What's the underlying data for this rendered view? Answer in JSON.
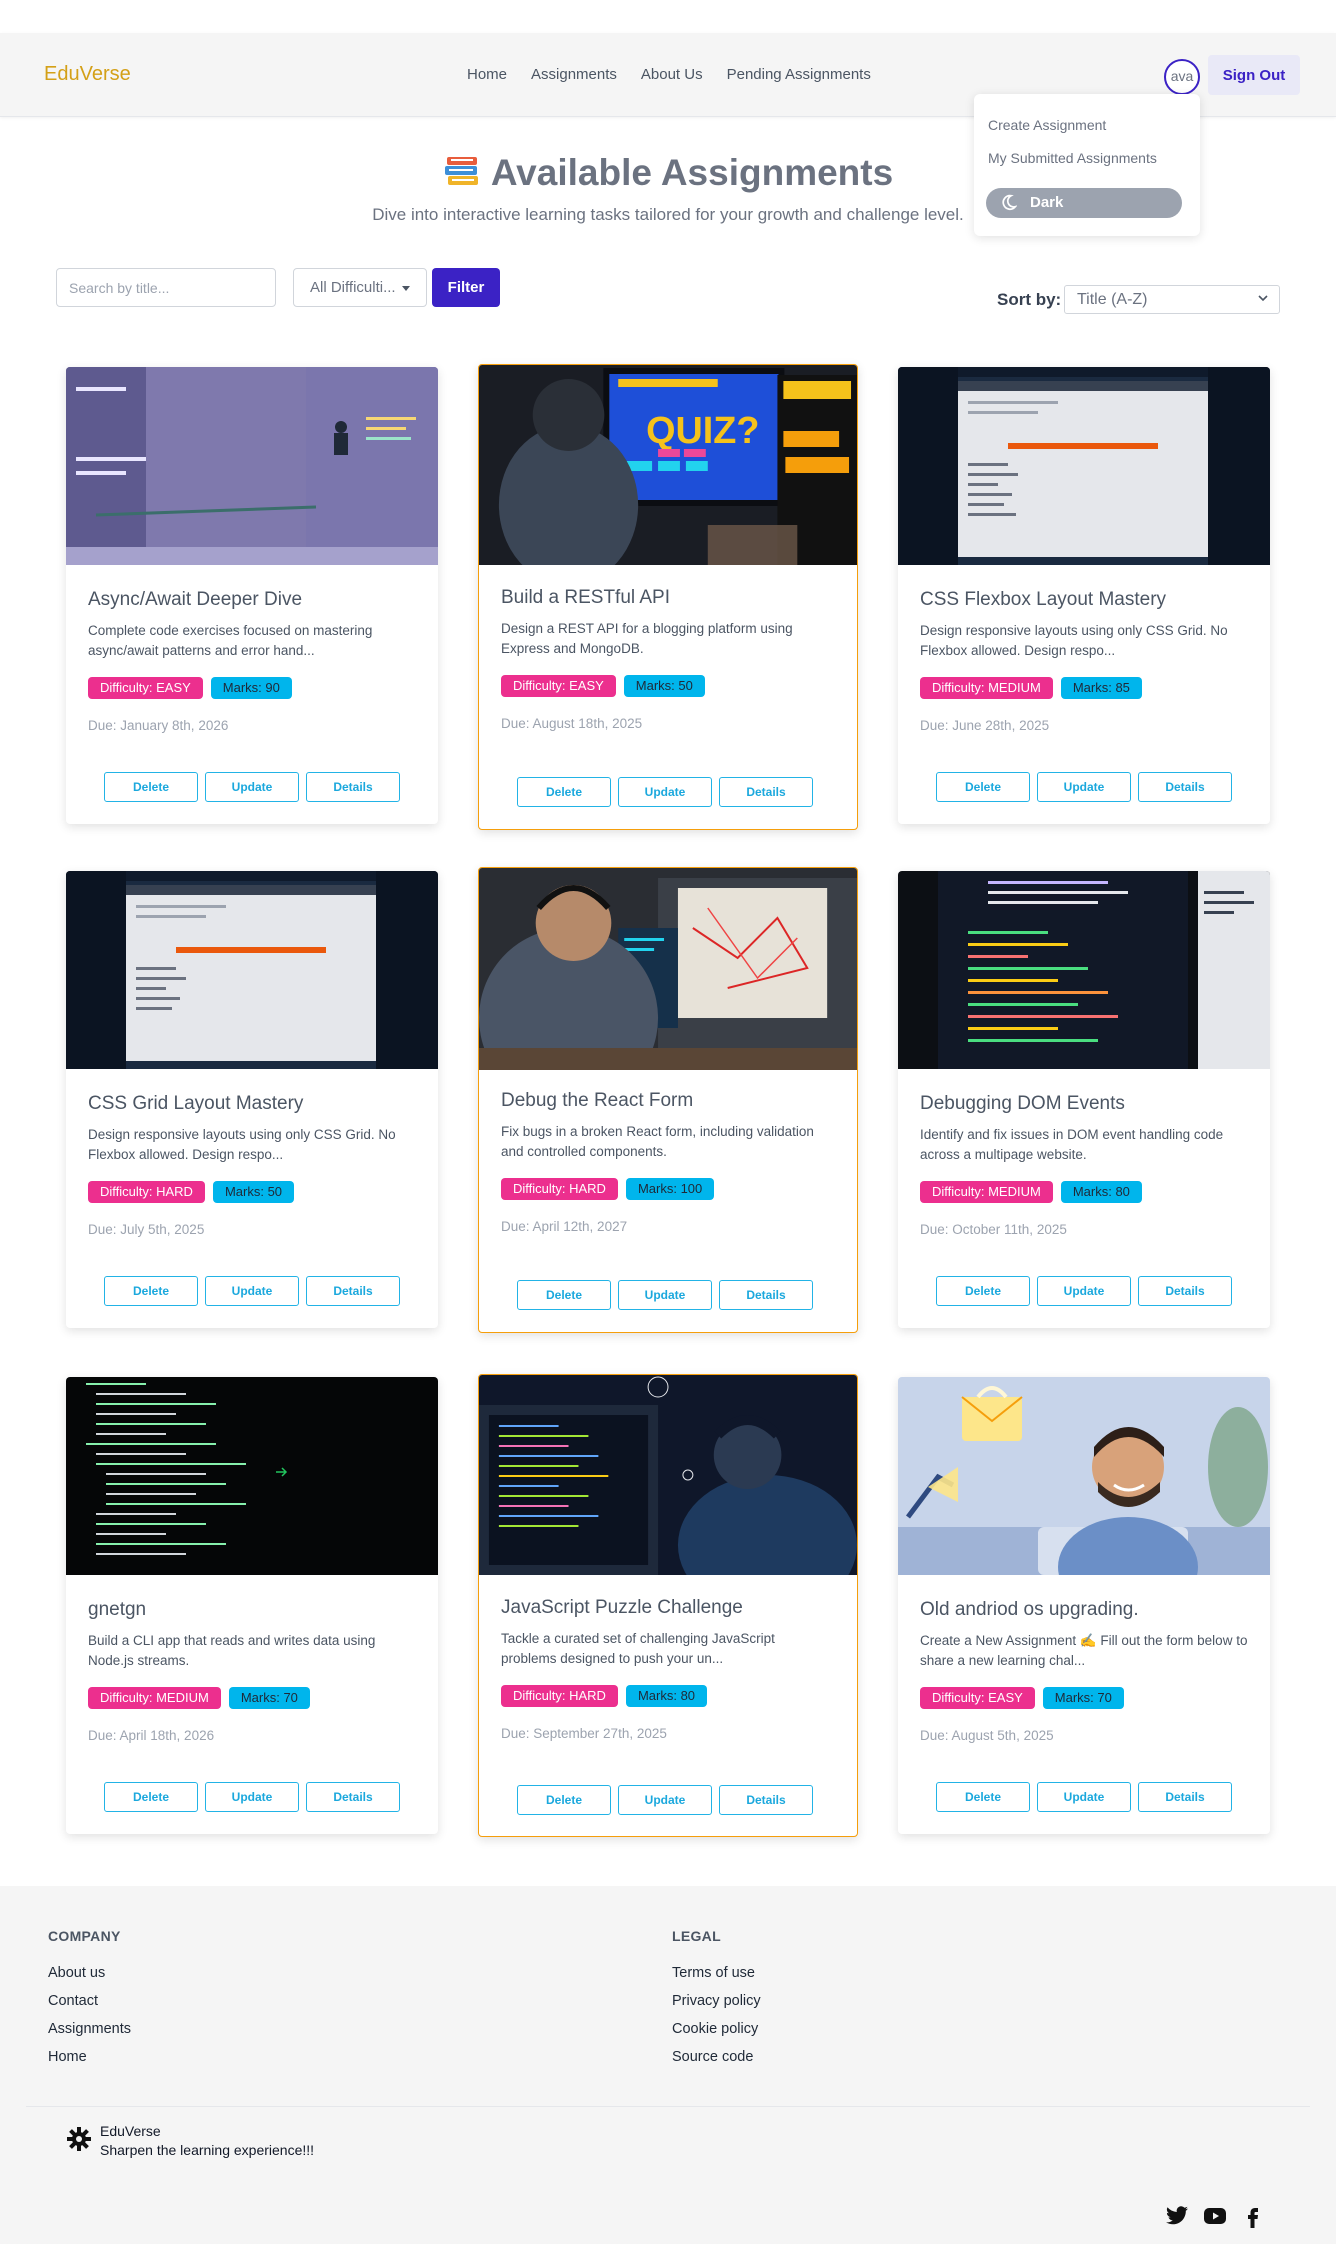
{
  "nav": {
    "brand": "EduVerse",
    "links": [
      "Home",
      "Assignments",
      "About Us",
      "Pending Assignments"
    ],
    "avatar_text": "ava",
    "signout": "Sign Out"
  },
  "user_menu": {
    "items": [
      "Create Assignment",
      "My Submitted Assignments"
    ],
    "theme_toggle": "Dark"
  },
  "hero": {
    "emoji": "books-icon",
    "title": "Available Assignments",
    "subtitle": "Dive into interactive learning tasks tailored for your growth and challenge level."
  },
  "filters": {
    "search_placeholder": "Search by title...",
    "difficulty_selected": "All Difficulti...",
    "filter_button": "Filter",
    "sort_label": "Sort by:",
    "sort_selected": "Title (A-Z)"
  },
  "colors": {
    "brand": "#d4a017",
    "primary": "#3b22c5",
    "difficulty_badge": "#ec2f8e",
    "marks_badge": "#00b5ec",
    "action_border": "#22b3e6",
    "featured_border": "#f59e0b"
  },
  "cards": [
    {
      "title": "Async/Await Deeper Dive",
      "description": "Complete code exercises focused on mastering async/await patterns and error hand...",
      "difficulty": "Difficulty: EASY",
      "marks": "Marks: 90",
      "due": "Due: January 8th, 2026",
      "image": "whiteboard-timeline-illustration",
      "delete": "Delete",
      "update": "Update",
      "details": "Details"
    },
    {
      "title": "Build a RESTful API",
      "description": "Design a REST API for a blogging platform using Express and MongoDB.",
      "difficulty": "Difficulty: EASY",
      "marks": "Marks: 50",
      "due": "Due: August 18th, 2025",
      "image": "quiz-monitor-photo",
      "quiz_text": "QUIZ?",
      "delete": "Delete",
      "update": "Update",
      "details": "Details"
    },
    {
      "title": "CSS Flexbox Layout Mastery",
      "description": "Design responsive layouts using only CSS Grid. No Flexbox allowed. Design respo...",
      "difficulty": "Difficulty: MEDIUM",
      "marks": "Marks: 85",
      "due": "Due: June 28th, 2025",
      "image": "laptop-code-photo",
      "delete": "Delete",
      "update": "Update",
      "details": "Details"
    },
    {
      "title": "CSS Grid Layout Mastery",
      "description": "Design responsive layouts using only CSS Grid. No Flexbox allowed. Design respo...",
      "difficulty": "Difficulty: HARD",
      "marks": "Marks: 50",
      "due": "Due: July 5th, 2025",
      "image": "laptop-code-photo",
      "delete": "Delete",
      "update": "Update",
      "details": "Details"
    },
    {
      "title": "Debug the React Form",
      "description": "Fix bugs in a broken React form, including validation and controlled components.",
      "difficulty": "Difficulty: HARD",
      "marks": "Marks: 100",
      "due": "Due: April 12th, 2027",
      "image": "developer-headset-photo",
      "delete": "Delete",
      "update": "Update",
      "details": "Details"
    },
    {
      "title": "Debugging DOM Events",
      "description": "Identify and fix issues in DOM event handling code across a multipage website.",
      "difficulty": "Difficulty: MEDIUM",
      "marks": "Marks: 80",
      "due": "Due: October 11th, 2025",
      "image": "code-screen-photo",
      "delete": "Delete",
      "update": "Update",
      "details": "Details"
    },
    {
      "title": "gnetgn",
      "description": "Build a CLI app that reads and writes data using Node.js streams.",
      "difficulty": "Difficulty: MEDIUM",
      "marks": "Marks: 70",
      "due": "Due: April 18th, 2026",
      "image": "terminal-green-code",
      "delete": "Delete",
      "update": "Update",
      "details": "Details"
    },
    {
      "title": "JavaScript Puzzle Challenge",
      "description": "Tackle a curated set of challenging JavaScript problems designed to push your un...",
      "difficulty": "Difficulty: HARD",
      "marks": "Marks: 80",
      "due": "Due: September 27th, 2025",
      "image": "developer-night-photo",
      "delete": "Delete",
      "update": "Update",
      "details": "Details"
    },
    {
      "title": "Old andriod os upgrading.",
      "description": "Create a New Assignment ✍️ Fill out the form below to share a new learning chal...",
      "difficulty": "Difficulty: EASY",
      "marks": "Marks: 70",
      "due": "Due: August 5th, 2025",
      "image": "smiling-man-illustration",
      "delete": "Delete",
      "update": "Update",
      "details": "Details"
    }
  ],
  "footer": {
    "company_heading": "COMPANY",
    "company_links": [
      "About us",
      "Contact",
      "Assignments",
      "Home"
    ],
    "legal_heading": "LEGAL",
    "legal_links": [
      "Terms of use",
      "Privacy policy",
      "Cookie policy",
      "Source code"
    ],
    "brand": "EduVerse",
    "tagline": "Sharpen the learning experience!!!",
    "social": [
      "twitter-icon",
      "youtube-icon",
      "facebook-icon"
    ]
  }
}
